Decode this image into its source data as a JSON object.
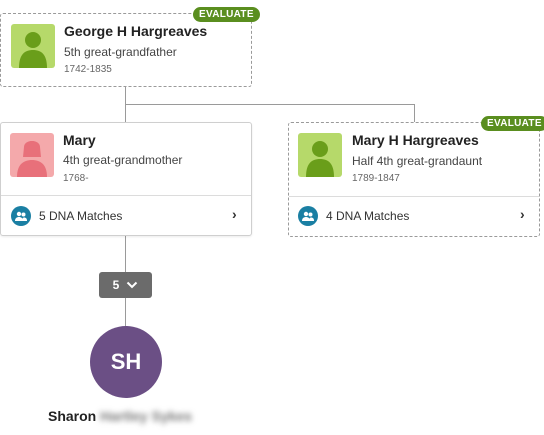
{
  "top_person": {
    "badge": "EVALUATE",
    "name": "George H Hargreaves",
    "relationship": "5th great-grandfather",
    "dates": "1742-1835"
  },
  "left_person": {
    "name": "Mary",
    "relationship": "4th great-grandmother",
    "dates": "1768-",
    "dna_label": "5 DNA Matches"
  },
  "right_person": {
    "badge": "EVALUATE",
    "name": "Mary H Hargreaves",
    "relationship": "Half 4th great-grandaunt",
    "dates": "1789-1847",
    "dna_label": "4 DNA Matches"
  },
  "expand_button": {
    "count": "5"
  },
  "me": {
    "initials": "SH",
    "first_name": "Sharon",
    "redacted_rest": "Hartley Sykes"
  },
  "colors": {
    "evaluate_badge": "#5a8e1f",
    "male_avatar_bg": "#b6d96a",
    "male_avatar_fg": "#6a9e1a",
    "female_avatar_bg": "#f4a9ab",
    "female_avatar_fg": "#e8707a",
    "dna_icon": "#1a7fa3",
    "me_circle": "#6b4f85"
  }
}
